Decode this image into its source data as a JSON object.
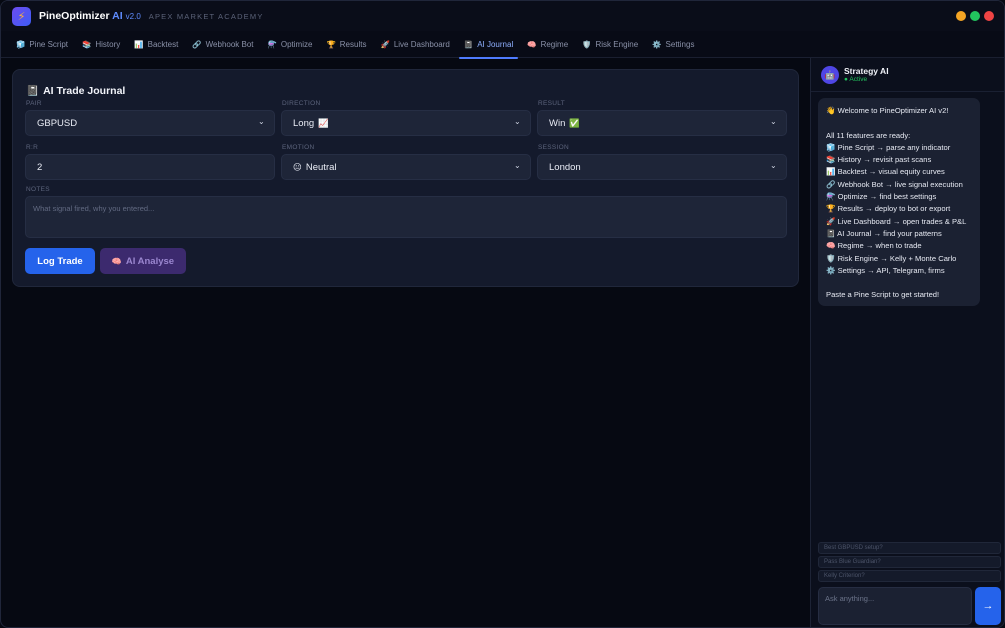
{
  "app": {
    "name": "PineOptimizer",
    "name_ai": "AI",
    "version": "v2.0",
    "subtitle": "APEX MARKET ACADEMY",
    "logo_icon": "lightning-icon"
  },
  "colors": {
    "accent": "#2563eb",
    "tab_active": "#8fb0ff",
    "win_minimize": "#f5a524",
    "win_maximize": "#22c55e",
    "win_close": "#ef4444",
    "status_active": "#22c55e"
  },
  "tabs": [
    {
      "icon": "🧊",
      "label": "Pine Script"
    },
    {
      "icon": "📚",
      "label": "History"
    },
    {
      "icon": "📊",
      "label": "Backtest"
    },
    {
      "icon": "🔗",
      "label": "Webhook Bot"
    },
    {
      "icon": "⚗️",
      "label": "Optimize"
    },
    {
      "icon": "🏆",
      "label": "Results"
    },
    {
      "icon": "🚀",
      "label": "Live Dashboard"
    },
    {
      "icon": "📓",
      "label": "AI Journal",
      "active": true
    },
    {
      "icon": "🧠",
      "label": "Regime"
    },
    {
      "icon": "🛡️",
      "label": "Risk Engine"
    },
    {
      "icon": "⚙️",
      "label": "Settings"
    }
  ],
  "journal": {
    "title_icon": "📓",
    "title": "AI Trade Journal",
    "pair": {
      "label": "PAIR",
      "value": "GBPUSD"
    },
    "direction": {
      "label": "DIRECTION",
      "value": "Long",
      "emoji": "📈"
    },
    "result": {
      "label": "RESULT",
      "value": "Win",
      "emoji": "✅"
    },
    "rr": {
      "label": "R:R",
      "value": "2"
    },
    "emotion": {
      "label": "EMOTION",
      "value": "Neutral",
      "emoji": "😐"
    },
    "session": {
      "label": "SESSION",
      "value": "London"
    },
    "notes": {
      "label": "NOTES",
      "placeholder": "What signal fired, why you entered..."
    },
    "log_button": "Log Trade",
    "ai_button_icon": "🧠",
    "ai_button": "AI Analyse"
  },
  "assistant": {
    "avatar": "🤖",
    "name": "Strategy AI",
    "status": "● Active",
    "welcome": "👋 Welcome to PineOptimizer AI v2!",
    "features_heading": "All 11 features are ready:",
    "features": [
      "🧊 Pine Script → parse any indicator",
      "📚 History → revisit past scans",
      "📊 Backtest → visual equity curves",
      "🔗 Webhook Bot → live signal execution",
      "⚗️ Optimize → find best settings",
      "🏆 Results → deploy to bot or export",
      "🚀 Live Dashboard → open trades & P&L",
      "📓 AI Journal → find your patterns",
      "🧠 Regime → when to trade",
      "🛡️ Risk Engine → Kelly + Monte Carlo",
      "⚙️ Settings → API, Telegram, firms"
    ],
    "closing": "Paste a Pine Script to get started!",
    "suggestions": [
      "Best GBPUSD setup?",
      "Pass Blue Guardian?",
      "Kelly Criterion?"
    ],
    "input_placeholder": "Ask anything...",
    "send_icon": "→"
  }
}
